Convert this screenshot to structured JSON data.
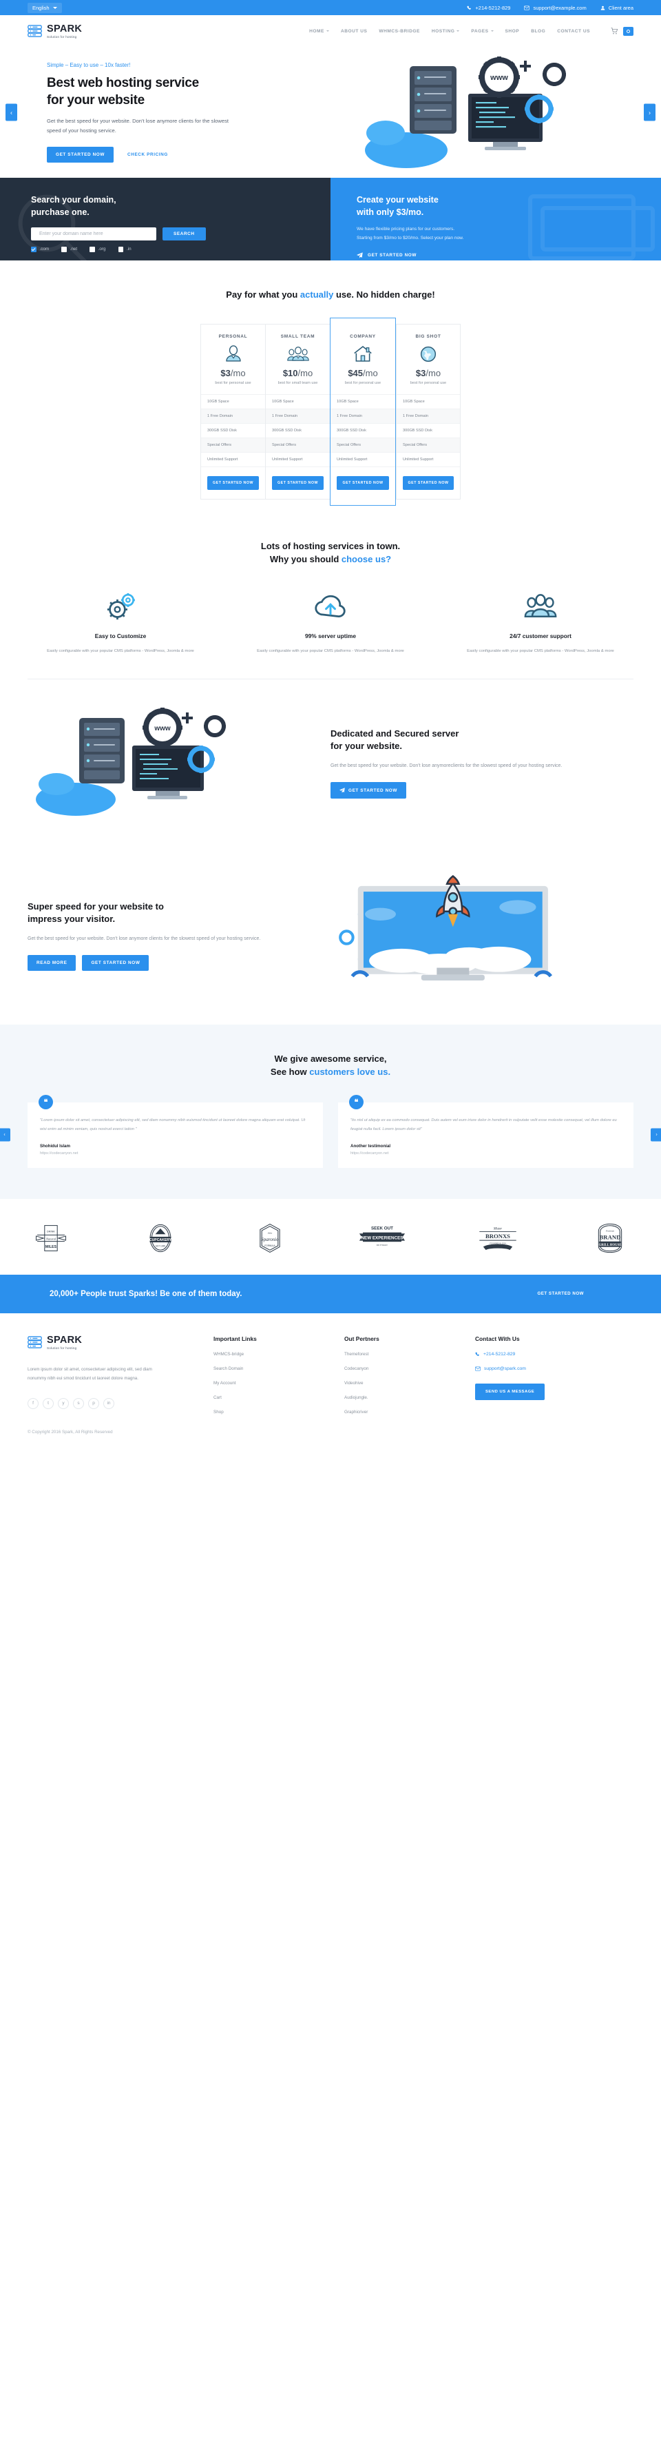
{
  "topbar": {
    "language": "English",
    "phone": "+214-5212-829",
    "email": "support@example.com",
    "client_area": "Client area"
  },
  "nav": {
    "brand": "SPARK",
    "brand_tagline": "Solution for hosting",
    "items": [
      {
        "label": "HOME",
        "has_caret": true
      },
      {
        "label": "ABOUT US",
        "has_caret": false
      },
      {
        "label": "WHMCS-BRIDGE",
        "has_caret": false
      },
      {
        "label": "HOSTING",
        "has_caret": true
      },
      {
        "label": "PAGES",
        "has_caret": true
      },
      {
        "label": "SHOP",
        "has_caret": false
      },
      {
        "label": "BLOG",
        "has_caret": false
      },
      {
        "label": "CONTACT US",
        "has_caret": false
      }
    ]
  },
  "hero": {
    "kicker": "Simple – Easy to use – 10x faster!",
    "title_line1": "Best web hosting service",
    "title_line2": "for your website",
    "desc": "Get the best speed for your website. Don't lose anymore clients for the slowest speed of your hosting service.",
    "primary_btn": "GET STARTED NOW",
    "link_btn": "CHECK PRICING",
    "prev_arrow": "‹",
    "next_arrow": "›"
  },
  "domain": {
    "title_line1": "Search your domain,",
    "title_line2": "purchase one.",
    "input_placeholder": "Enter your domain name here",
    "input_value": "",
    "search_btn": "SEARCH",
    "tlds": [
      {
        "label": ".com",
        "checked": true
      },
      {
        "label": ".net",
        "checked": false
      },
      {
        "label": ".org",
        "checked": false
      },
      {
        "label": ".in",
        "checked": false
      }
    ]
  },
  "promo": {
    "title_line1": "Create your website",
    "title_line2": "with only $3/mo.",
    "desc_line1": "We have flexible pricing plans for our customers.",
    "desc_line2": "Starting from $3/mo to $20/mo. Select your plan now.",
    "cta": "GET STARTED NOW"
  },
  "pricing": {
    "title_pre": "Pay for what you ",
    "title_accent": "actually",
    "title_post": " use. No hidden charge!",
    "plans": [
      {
        "name": "PERSONAL",
        "icon": "person-icon",
        "price_amount": "$3",
        "price_period": "/mo",
        "subtitle": "best for personal use",
        "features": [
          "10GB Space",
          "1 Free Domain",
          "300GB SSD Disk",
          "Special Offers",
          "Unlimited Support"
        ],
        "button": "GET STARTED NOW",
        "featured": false
      },
      {
        "name": "SMALL TEAM",
        "icon": "group-icon",
        "price_amount": "$10",
        "price_period": "/mo",
        "subtitle": "best for small team use",
        "features": [
          "10GB Space",
          "1 Free Domain",
          "300GB SSD Disk",
          "Special Offers",
          "Unlimited Support"
        ],
        "button": "GET STARTED NOW",
        "featured": false
      },
      {
        "name": "COMPANY",
        "icon": "house-icon",
        "price_amount": "$45",
        "price_period": "/mo",
        "subtitle": "best for personal use",
        "features": [
          "10GB Space",
          "1 Free Domain",
          "300GB SSD Disk",
          "Special Offers",
          "Unlimited Support"
        ],
        "button": "GET STARTED NOW",
        "featured": true
      },
      {
        "name": "BIG SHOT",
        "icon": "globe-icon",
        "price_amount": "$3",
        "price_period": "/mo",
        "subtitle": "best for personal use",
        "features": [
          "10GB Space",
          "1 Free Domain",
          "300GB SSD Disk",
          "Special Offers",
          "Unlimited Support"
        ],
        "button": "GET STARTED NOW",
        "featured": false
      }
    ]
  },
  "why": {
    "title_line1": "Lots of hosting services in town.",
    "title_line2_pre": "Why you should ",
    "title_line2_accent": "choose us?",
    "features": [
      {
        "icon": "gears-icon",
        "title": "Easy to Customize",
        "desc": "Easily configurable with your popular CMS platforms - WordPress, Joomla & more"
      },
      {
        "icon": "cloud-upload-icon",
        "title": "99% server uptime",
        "desc": "Easily configurable with your popular CMS platforms - WordPress, Joomla & more"
      },
      {
        "icon": "support-team-icon",
        "title": "24/7 customer support",
        "desc": "Easily configurable with your popular CMS platforms - WordPress, Joomla & more"
      }
    ]
  },
  "dedicated": {
    "title_line1": "Dedicated and Secured server",
    "title_line2": "for your website.",
    "desc": "Get the best speed for your website. Don't lose anymoreclients for the slowest speed of your hosting service.",
    "button": "GET STARTED NOW"
  },
  "superspeed": {
    "title_line1": "Super speed for your website to",
    "title_line2": "impress your visitor.",
    "desc": "Get the best speed for your website. Don't lose anymore clients for the slowest speed of your hosting service.",
    "button_read": "READ MORE",
    "button_start": "GET STARTED NOW"
  },
  "testimonials": {
    "title_line1": "We give awesome service,",
    "title_line2_pre": "See how ",
    "title_line2_accent": "customers love us.",
    "prev_arrow": "‹",
    "next_arrow": "›",
    "items": [
      {
        "quote": "\"Lorem ipsum dolor sit amet, consectetuer adipiscing elit, sed diam nonummy nibh euismod tincidunt ut laoreet dolore magna aliquam erat volutpat. Ut wisi enim ad minim veniam, quis nostrud exerci tation \"",
        "name": "Shohidul Islam",
        "url": "https://codecanyon.net"
      },
      {
        "quote": "\"tis nisl ut aliquip ex ea commodo consequat. Duis autem vel eum iriure dolor in hendrerit in vulputate velit esse molestie consequat, vel illum dolore eu feugiat nulla facil. Lorem ipsum dolor sit\"",
        "name": "Another testimonial",
        "url": "https://codecanyon.net"
      }
    ]
  },
  "brands": [
    {
      "name": "DRINK NATURAL MILES",
      "top": "DRINK",
      "mid": "Natural",
      "bot": "MILES"
    },
    {
      "name": "CUPCAKERY",
      "top": "",
      "mid": "CUPCAKERY",
      "bot": "EST 1935"
    },
    {
      "name": "Sparonio",
      "top": "Atlas",
      "mid": "Sparonio",
      "bot": "FORMULA"
    },
    {
      "name": "SEEK OUT NEW EXPERIENCES",
      "top": "SEEK OUT",
      "mid": "NEW EXPERIENCES",
      "bot": "DO IT DAILY"
    },
    {
      "name": "Mister BRONXS",
      "top": "Mister",
      "mid": "BRONXS",
      "bot": "FOUNDED IN 1914"
    },
    {
      "name": "BRAND GRILL HOUSE",
      "top": "Premium",
      "mid": "BRAND",
      "bot": "GRILL HOUSE"
    }
  ],
  "cta": {
    "text": "20,000+ People trust Sparks! Be one of them today.",
    "button": "GET STARTED NOW"
  },
  "footer": {
    "brand": "SPARK",
    "brand_tagline": "Solution for hosting",
    "about": "Lorem ipsum dolor sit amet, consectetuer adipiscing elit, sed diam nonummy nibh eui smod tincidunt ut laoreet dolore magna.",
    "socials": [
      {
        "name": "facebook-icon",
        "glyph": "f"
      },
      {
        "name": "twitter-icon",
        "glyph": "t"
      },
      {
        "name": "youtube-icon",
        "glyph": "y"
      },
      {
        "name": "skype-icon",
        "glyph": "s"
      },
      {
        "name": "pinterest-icon",
        "glyph": "p"
      },
      {
        "name": "linkedin-icon",
        "glyph": "in"
      }
    ],
    "links_heading": "Important Links",
    "links": [
      "WHMCS-bridge",
      "Search Domain",
      "My Account",
      "Cart",
      "Shop"
    ],
    "partners_heading": "Out Pertners",
    "partners": [
      "Themeforest",
      "Codecanyon",
      "Videohive",
      "Audiojungle.",
      "Graphicriver"
    ],
    "contact_heading": "Contact With Us",
    "contact_phone": "+214-5212-829",
    "contact_email": "support@spark.com",
    "contact_button": "SEND US A MESSAGE",
    "copyright": "© Copyright 2016 Spark, All Rights Reserved"
  },
  "colors": {
    "accent": "#2b90ed",
    "dark": "#24303f",
    "muted": "#8a929c"
  }
}
